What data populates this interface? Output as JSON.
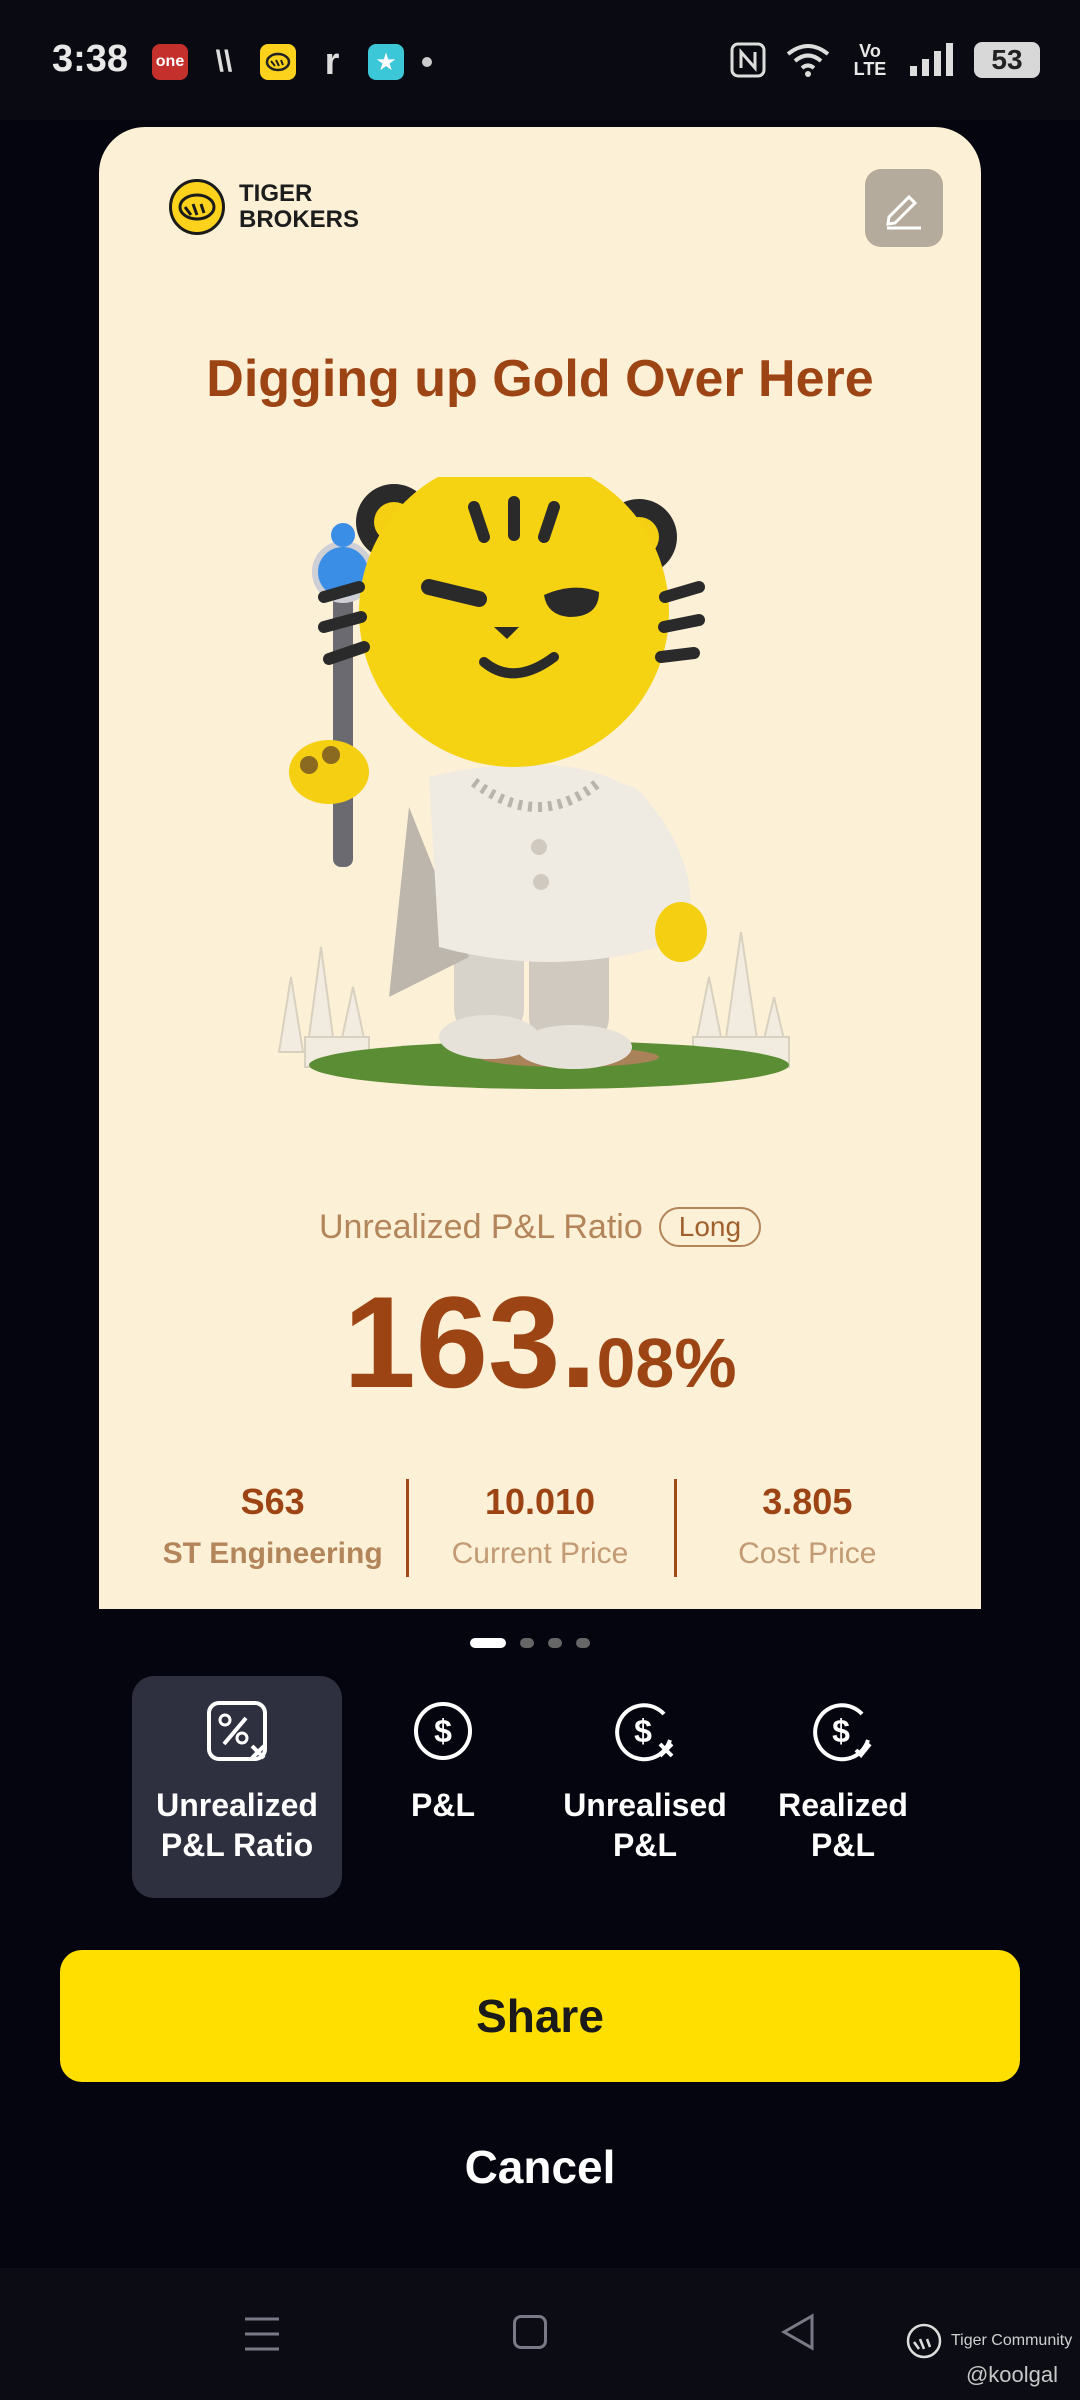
{
  "status_bar": {
    "time": "3:38",
    "apps": [
      {
        "name": "one-app-icon",
        "label": "one",
        "bg": "#c4302b"
      },
      {
        "name": "stripes-app-icon",
        "label": "\\\\",
        "bg": "transparent"
      },
      {
        "name": "tiger-app-icon",
        "label": "",
        "bg": "#fcd21c"
      },
      {
        "name": "r-app-icon",
        "label": "r",
        "bg": "transparent"
      },
      {
        "name": "star-app-icon",
        "label": "★",
        "bg": "#3cc7d8"
      }
    ],
    "network": "Vo LTE",
    "battery": "53"
  },
  "card": {
    "brand_line1": "TIGER",
    "brand_line2": "BROKERS",
    "headline": "Digging up Gold Over Here",
    "metric_label": "Unrealized P&L Ratio",
    "position_tag": "Long",
    "value_int": "163.",
    "value_dec": "08%",
    "stats": [
      {
        "value": "S63",
        "label": "ST Engineering"
      },
      {
        "value": "10.010",
        "label": "Current Price"
      },
      {
        "value": "3.805",
        "label": "Cost Price"
      }
    ]
  },
  "pager": {
    "count": 4,
    "active": 0
  },
  "options": [
    {
      "line1": "Unrealized",
      "line2": "P&L Ratio",
      "icon": "percent-icon",
      "selected": true
    },
    {
      "line1": "P&L",
      "line2": "",
      "icon": "dollar-icon",
      "selected": false
    },
    {
      "line1": "Unrealised",
      "line2": "P&L",
      "icon": "dollar-x-icon",
      "selected": false
    },
    {
      "line1": "Realized",
      "line2": "P&L",
      "icon": "dollar-check-icon",
      "selected": false
    }
  ],
  "share_label": "Share",
  "cancel_label": "Cancel",
  "watermark": {
    "brand": "Tiger Community",
    "handle": "@koolgal"
  },
  "colors": {
    "accent": "#ffdf00",
    "card_bg": "#fcf0d6",
    "headline": "#9c4414",
    "background": "#05050f"
  }
}
